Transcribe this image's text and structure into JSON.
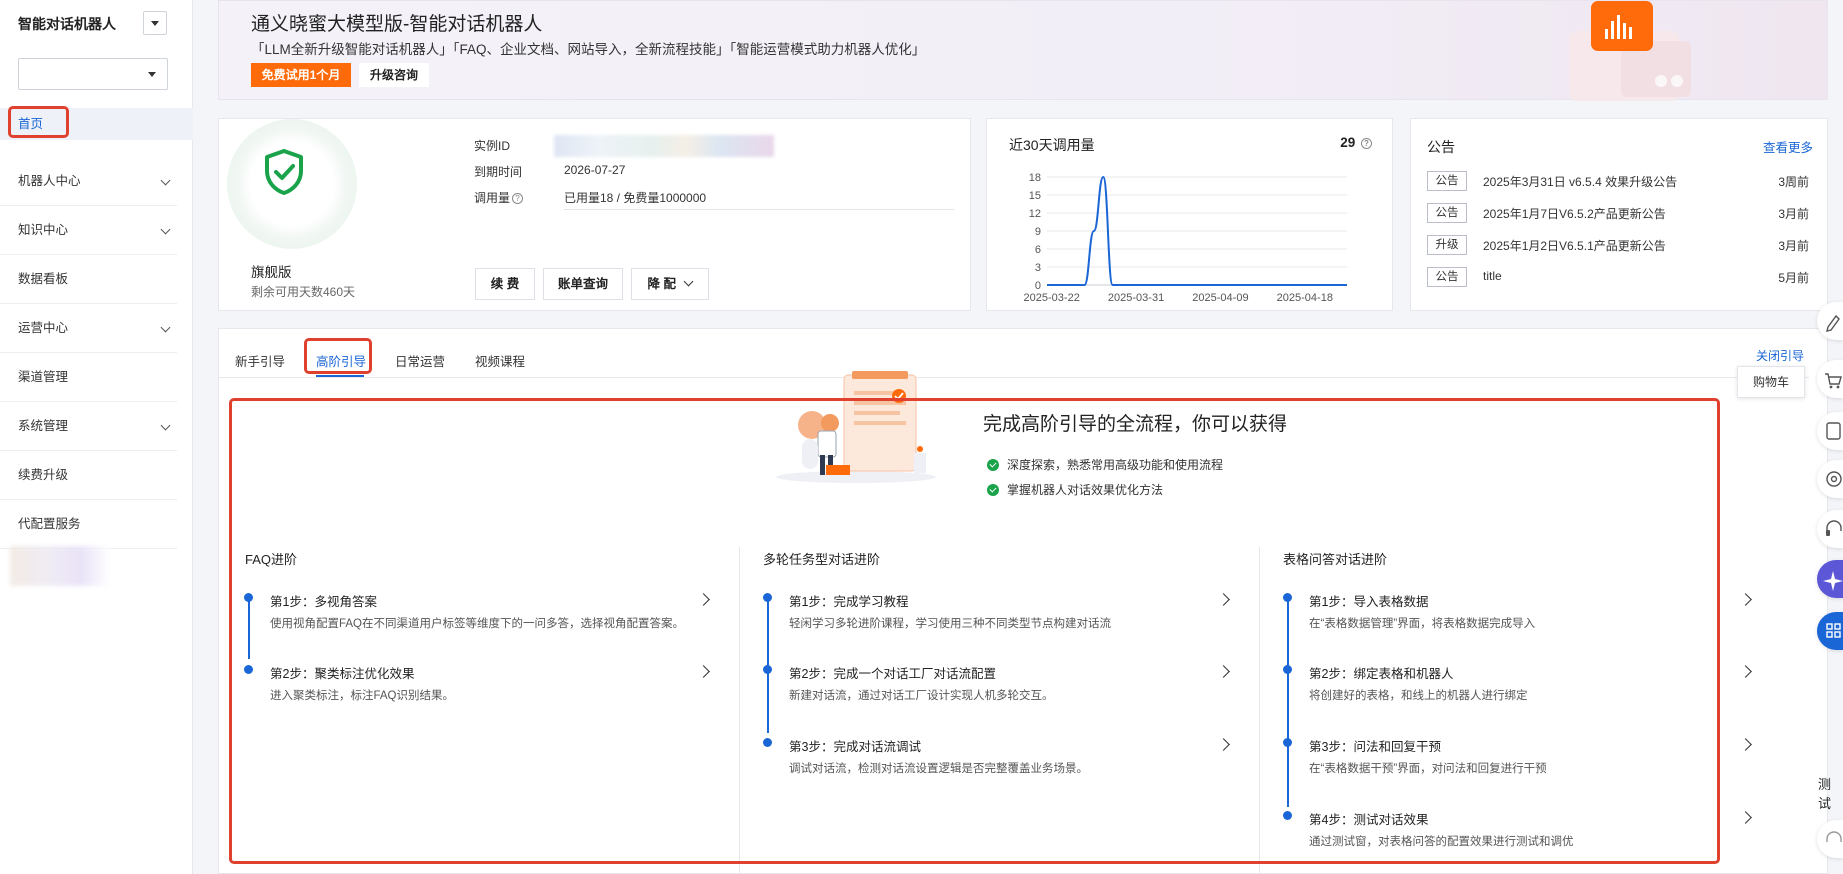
{
  "sidebar": {
    "title": "智能对话机器人",
    "items": [
      {
        "label": "首页",
        "chevron": false
      },
      {
        "label": "机器人中心",
        "chevron": true
      },
      {
        "label": "知识中心",
        "chevron": true
      },
      {
        "label": "数据看板",
        "chevron": false
      },
      {
        "label": "运营中心",
        "chevron": true
      },
      {
        "label": "渠道管理",
        "chevron": false
      },
      {
        "label": "系统管理",
        "chevron": true
      },
      {
        "label": "续费升级",
        "chevron": false
      },
      {
        "label": "代配置服务",
        "chevron": false
      }
    ]
  },
  "banner": {
    "title": "通义晓蜜大模型版-智能对话机器人",
    "subtitle": "「LLM全新升级智能对话机器人」「FAQ、企业文档、网站导入，全新流程技能」「智能运营模式助力机器人优化」",
    "trial_label": "免费试用1个月",
    "consult_label": "升级咨询"
  },
  "instance": {
    "edition": "旗舰版",
    "remaining": "剩余可用天数460天",
    "id_label": "实例ID",
    "expire_label": "到期时间",
    "expire_value": "2026-07-27",
    "usage_label": "调用量",
    "usage_value": "已用量18 / 免费量1000000",
    "renew_label": "续 费",
    "bill_label": "账单查询",
    "downgrade_label": "降 配"
  },
  "usage_chart": {
    "title": "近30天调用量",
    "total": "29"
  },
  "chart_data": {
    "type": "line",
    "title": "近30天调用量",
    "x_ticks": [
      "2025-03-22",
      "2025-03-31",
      "2025-04-09",
      "2025-04-18"
    ],
    "y_ticks": [
      0,
      3,
      6,
      9,
      12,
      15,
      18
    ],
    "ylim": [
      0,
      18
    ],
    "series": [
      {
        "points": [
          [
            0,
            0
          ],
          [
            4,
            0
          ],
          [
            5,
            9
          ],
          [
            6,
            18
          ],
          [
            7,
            0
          ],
          [
            32,
            0
          ]
        ]
      }
    ],
    "grid": true
  },
  "notices": {
    "title": "公告",
    "more_label": "查看更多",
    "items": [
      {
        "tag": "公告",
        "text": "2025年3月31日 v6.5.4 效果升级公告",
        "time": "3周前"
      },
      {
        "tag": "公告",
        "text": "2025年1月7日V6.5.2产品更新公告",
        "time": "3月前"
      },
      {
        "tag": "升级",
        "text": "2025年1月2日V6.5.1产品更新公告",
        "time": "3月前"
      },
      {
        "tag": "公告",
        "text": "title",
        "time": "5月前"
      }
    ]
  },
  "guide": {
    "tabs": [
      "新手引导",
      "高阶引导",
      "日常运营",
      "视频课程"
    ],
    "close_label": "关闭引导",
    "gain_title": "完成高阶引导的全流程，你可以获得",
    "gains": [
      "深度探索，熟悉常用高级功能和使用流程",
      "掌握机器人对话效果优化方法"
    ],
    "columns": [
      {
        "title": "FAQ进阶",
        "steps": [
          {
            "title": "第1步：多视角答案",
            "desc": "使用视角配置FAQ在不同渠道用户标签等维度下的一问多答，选择视角配置答案。"
          },
          {
            "title": "第2步：聚类标注优化效果",
            "desc": "进入聚类标注，标注FAQ识别结果。"
          }
        ]
      },
      {
        "title": "多轮任务型对话进阶",
        "steps": [
          {
            "title": "第1步：完成学习教程",
            "desc": "轻闲学习多轮进阶课程，学习使用三种不同类型节点构建对话流"
          },
          {
            "title": "第2步：完成一个对话工厂对话流配置",
            "desc": "新建对话流，通过对话工厂设计实现人机多轮交互。"
          },
          {
            "title": "第3步：完成对话流调试",
            "desc": "调试对话流，检测对话流设置逻辑是否完整覆盖业务场景。"
          }
        ]
      },
      {
        "title": "表格问答对话进阶",
        "steps": [
          {
            "title": "第1步：导入表格数据",
            "desc": "在“表格数据管理”界面，将表格数据完成导入"
          },
          {
            "title": "第2步：绑定表格和机器人",
            "desc": "将创建好的表格，和线上的机器人进行绑定"
          },
          {
            "title": "第3步：问法和回复干预",
            "desc": "在“表格数据干预”界面，对问法和回复进行干预"
          },
          {
            "title": "第4步：测试对话效果",
            "desc": "通过测试窗，对表格问答的配置效果进行测试和调优"
          }
        ]
      }
    ]
  },
  "floating": {
    "cart_tip": "购物车",
    "test_label": "测试"
  },
  "colors": {
    "primary": "#1a66d6",
    "accent": "#ff6a0a",
    "highlight": "#e0412f",
    "success": "#1aa34a"
  }
}
